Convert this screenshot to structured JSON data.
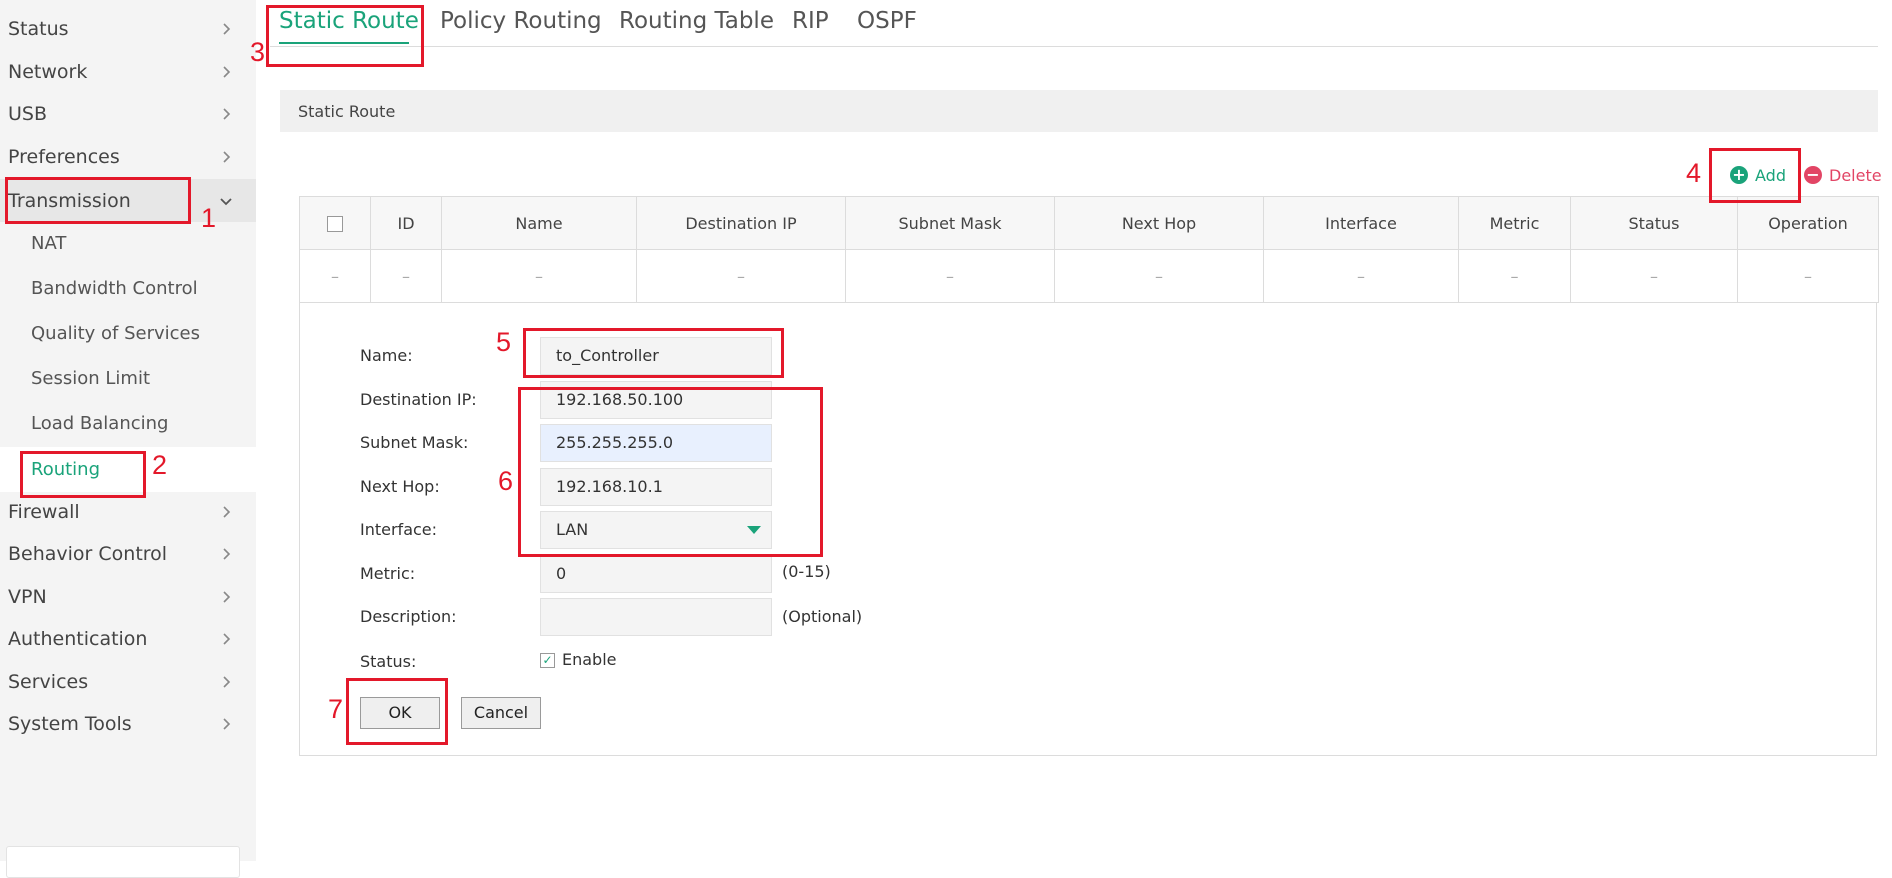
{
  "sidebar": {
    "items": [
      {
        "label": "Status"
      },
      {
        "label": "Network"
      },
      {
        "label": "USB"
      },
      {
        "label": "Preferences"
      },
      {
        "label": "Transmission"
      },
      {
        "label": "Firewall"
      },
      {
        "label": "Behavior Control"
      },
      {
        "label": "VPN"
      },
      {
        "label": "Authentication"
      },
      {
        "label": "Services"
      },
      {
        "label": "System Tools"
      }
    ],
    "submenu": [
      {
        "label": "NAT"
      },
      {
        "label": "Bandwidth Control"
      },
      {
        "label": "Quality of Services"
      },
      {
        "label": "Session Limit"
      },
      {
        "label": "Load Balancing"
      },
      {
        "label": "Routing"
      }
    ]
  },
  "tabs": [
    {
      "label": "Static Route"
    },
    {
      "label": "Policy Routing"
    },
    {
      "label": "Routing Table"
    },
    {
      "label": "RIP"
    },
    {
      "label": "OSPF"
    }
  ],
  "section": {
    "title": "Static Route"
  },
  "actions": {
    "add": "Add",
    "delete": "Delete"
  },
  "table": {
    "headers": [
      "ID",
      "Name",
      "Destination IP",
      "Subnet Mask",
      "Next Hop",
      "Interface",
      "Metric",
      "Status",
      "Operation"
    ],
    "empty_row": [
      "–",
      "–",
      "–",
      "–",
      "–",
      "–",
      "–",
      "–",
      "–",
      "–"
    ]
  },
  "form": {
    "name": {
      "label": "Name:",
      "value": "to_Controller"
    },
    "destination_ip": {
      "label": "Destination IP:",
      "value": "192.168.50.100"
    },
    "subnet_mask": {
      "label": "Subnet Mask:",
      "value": "255.255.255.0"
    },
    "next_hop": {
      "label": "Next Hop:",
      "value": "192.168.10.1"
    },
    "interface": {
      "label": "Interface:",
      "value": "LAN"
    },
    "metric": {
      "label": "Metric:",
      "value": "0",
      "hint": "(0-15)"
    },
    "description": {
      "label": "Description:",
      "value": "",
      "hint": "(Optional)"
    },
    "status": {
      "label": "Status:",
      "checkbox_label": "Enable",
      "checked": true
    },
    "ok": "OK",
    "cancel": "Cancel"
  },
  "annotations": [
    "1",
    "2",
    "3",
    "4",
    "5",
    "6",
    "7"
  ],
  "colors": {
    "accent": "#1aa37a",
    "danger": "#e24565",
    "annotation": "#e3182a"
  }
}
